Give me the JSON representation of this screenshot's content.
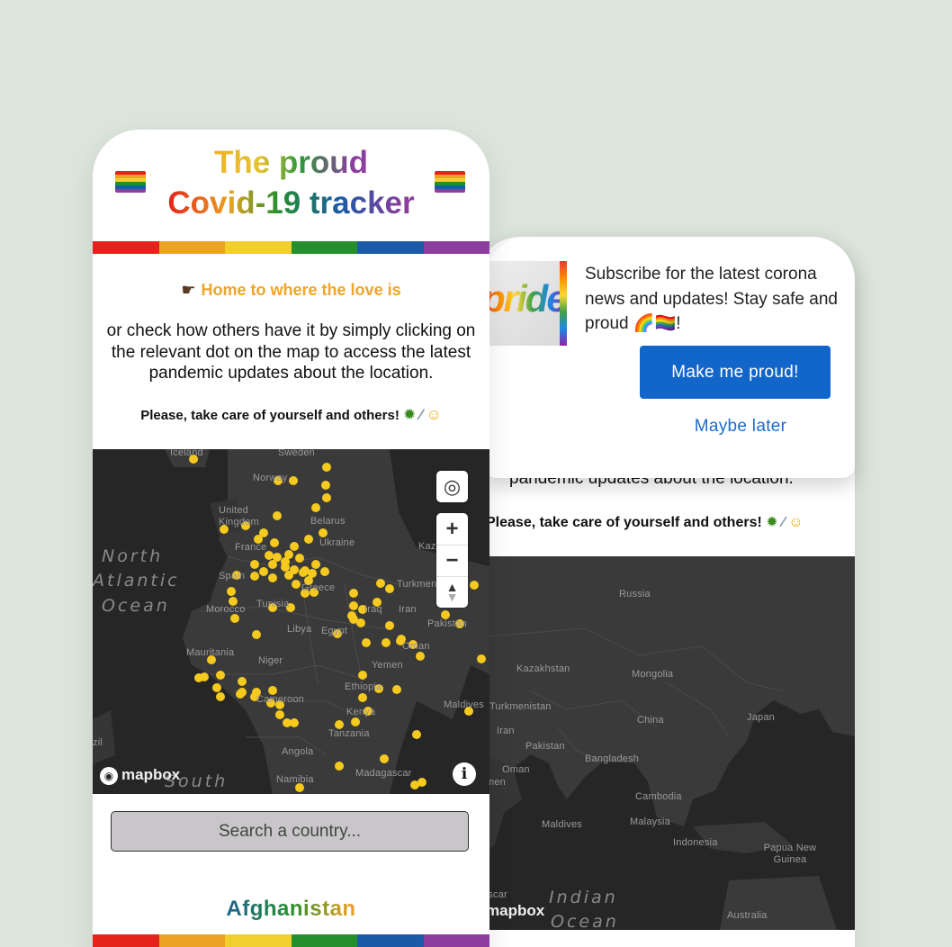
{
  "app": {
    "title_line1": "The proud",
    "title_line2": "Covid-19 tracker",
    "flag_icon": "rainbow-flag",
    "rainbow_colors": [
      "#e4231c",
      "#eca223",
      "#f0cf2f",
      "#24902d",
      "#1b5aa6",
      "#8b3e9e"
    ]
  },
  "intro": {
    "home_link": "Home to where the love is",
    "home_icon": "pointing-hand",
    "description": "or check how others have it by simply clicking on the relevant dot on the map to access the latest pandemic updates about the location.",
    "care_text": "Please, take care of yourself and others!",
    "care_emojis": [
      "virus",
      "syringe",
      "mask-face"
    ]
  },
  "map_left": {
    "labels": [
      "Iceland",
      "Sweden",
      "Norway",
      "United Kingdom",
      "Belarus",
      "France",
      "Ukraine",
      "Kaz",
      "Spain",
      "Greece",
      "Turkmen",
      "Morocco",
      "Tunisia",
      "Iran",
      "Iraq",
      "Libya",
      "Egypt",
      "Pakistan",
      "Mauritania",
      "Niger",
      "Oman",
      "Yemen",
      "Ethiopia",
      "Cameroon",
      "Maldives",
      "Kenya",
      "Tanzania",
      "Angola",
      "Madagascar",
      "Namibia",
      "zil"
    ],
    "ocean_north": [
      "North",
      "Atlantic",
      "Ocean"
    ],
    "ocean_south": "South",
    "attribution": "mapbox",
    "controls": [
      "locate-icon",
      "zoom-in-icon",
      "zoom-out-icon",
      "compass-icon"
    ],
    "info_icon": "info-icon"
  },
  "search": {
    "placeholder": "Search a country..."
  },
  "current_country": "Afghanistan",
  "popup": {
    "text": "Subscribe for the latest corona news and updates! Stay safe and proud",
    "emoji": "🌈🏳️‍🌈!",
    "image_word": "pride",
    "primary_button": "Make me proud!",
    "secondary_button": "Maybe later"
  },
  "back_screen": {
    "partial_text": "pandemic updates about the location.",
    "care_text": "Please, take care of yourself and others!",
    "map_labels": [
      "Russia",
      "Kazakhstan",
      "Mongolia",
      "Turkmenistan",
      "China",
      "Japan",
      "Iran",
      "Pakistan",
      "Bangladesh",
      "Oman",
      "men",
      "Cambodia",
      "Maldives",
      "Malaysia",
      "Indonesia",
      "Papua New Guinea",
      "Australia",
      "ascar"
    ],
    "ocean": [
      "Indian",
      "Ocean"
    ],
    "attribution": "mapbox"
  }
}
